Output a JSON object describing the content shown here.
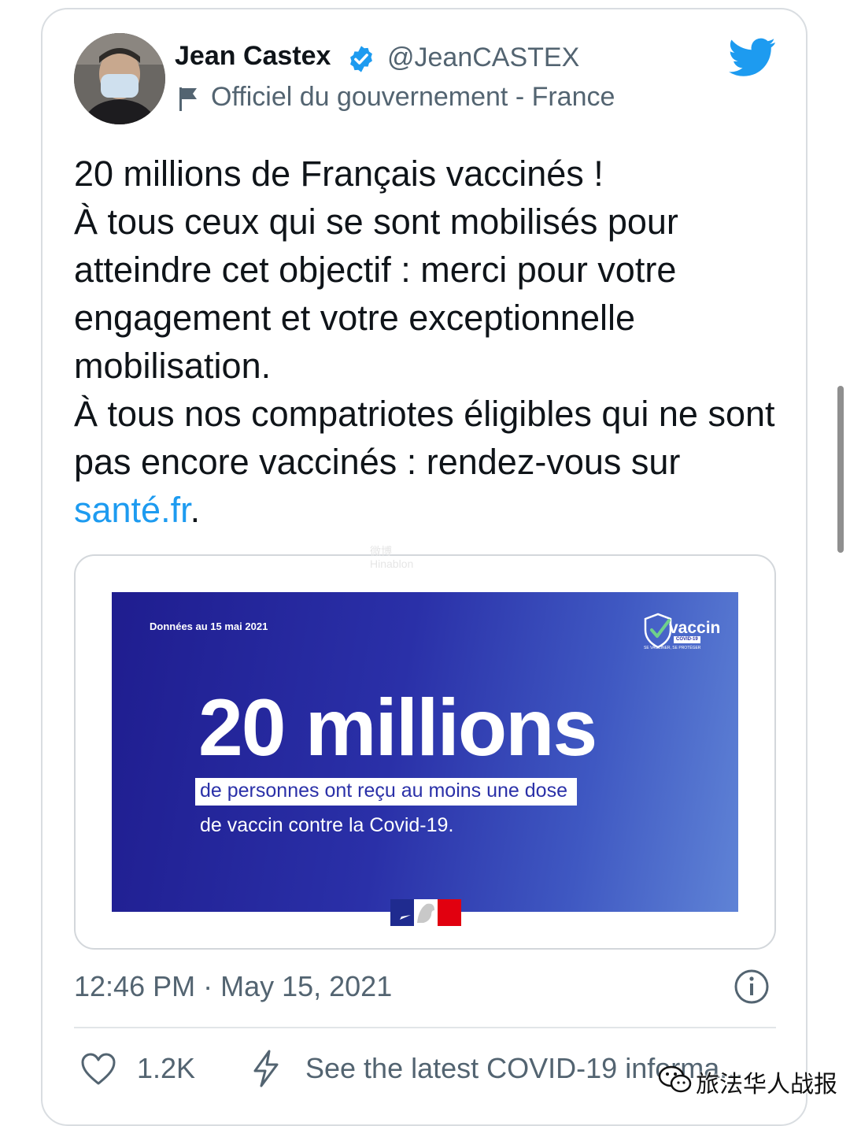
{
  "tweet": {
    "author_name": "Jean Castex",
    "handle": "@JeanCASTEX",
    "affiliation": "Officiel du gouvernement - France",
    "text_line1": "20 millions de Français vaccinés !",
    "text_para2": "À tous ceux qui se sont mobilisés pour atteindre cet objectif : merci pour votre engagement et votre exceptionnelle mobilisation.",
    "text_para3_prefix": "À tous nos compatriotes éligibles qui ne sont pas encore vaccinés : rendez-vous sur ",
    "link_text": "santé.fr",
    "text_para3_suffix": ".",
    "timestamp": "12:46 PM · May 15, 2021",
    "like_count": "1.2K",
    "covid_link": "See the latest COVID-19 informa..."
  },
  "media": {
    "date_label": "Données au 15 mai 2021",
    "logo_word": "vaccin",
    "logo_badge": "COVID-19",
    "logo_slogan": "SE VACCINER, SE PROTÉGER",
    "headline": "20 millions",
    "highlight_line": "de personnes ont reçu au moins une dose",
    "second_line": "de vaccin contre la Covid-19."
  },
  "watermark": {
    "line1": "微博",
    "line2": "Hinablon"
  },
  "wechat": {
    "account": "旅法华人战报"
  },
  "icons": {
    "verified": "verified-badge-icon",
    "flag": "flag-icon",
    "brand": "twitter-bird-icon",
    "info": "info-icon",
    "like": "heart-icon",
    "covid": "bolt-icon"
  },
  "colors": {
    "link": "#1d9bf0",
    "text": "#0f1419",
    "muted": "#536471",
    "banner": "#2a30a8"
  }
}
